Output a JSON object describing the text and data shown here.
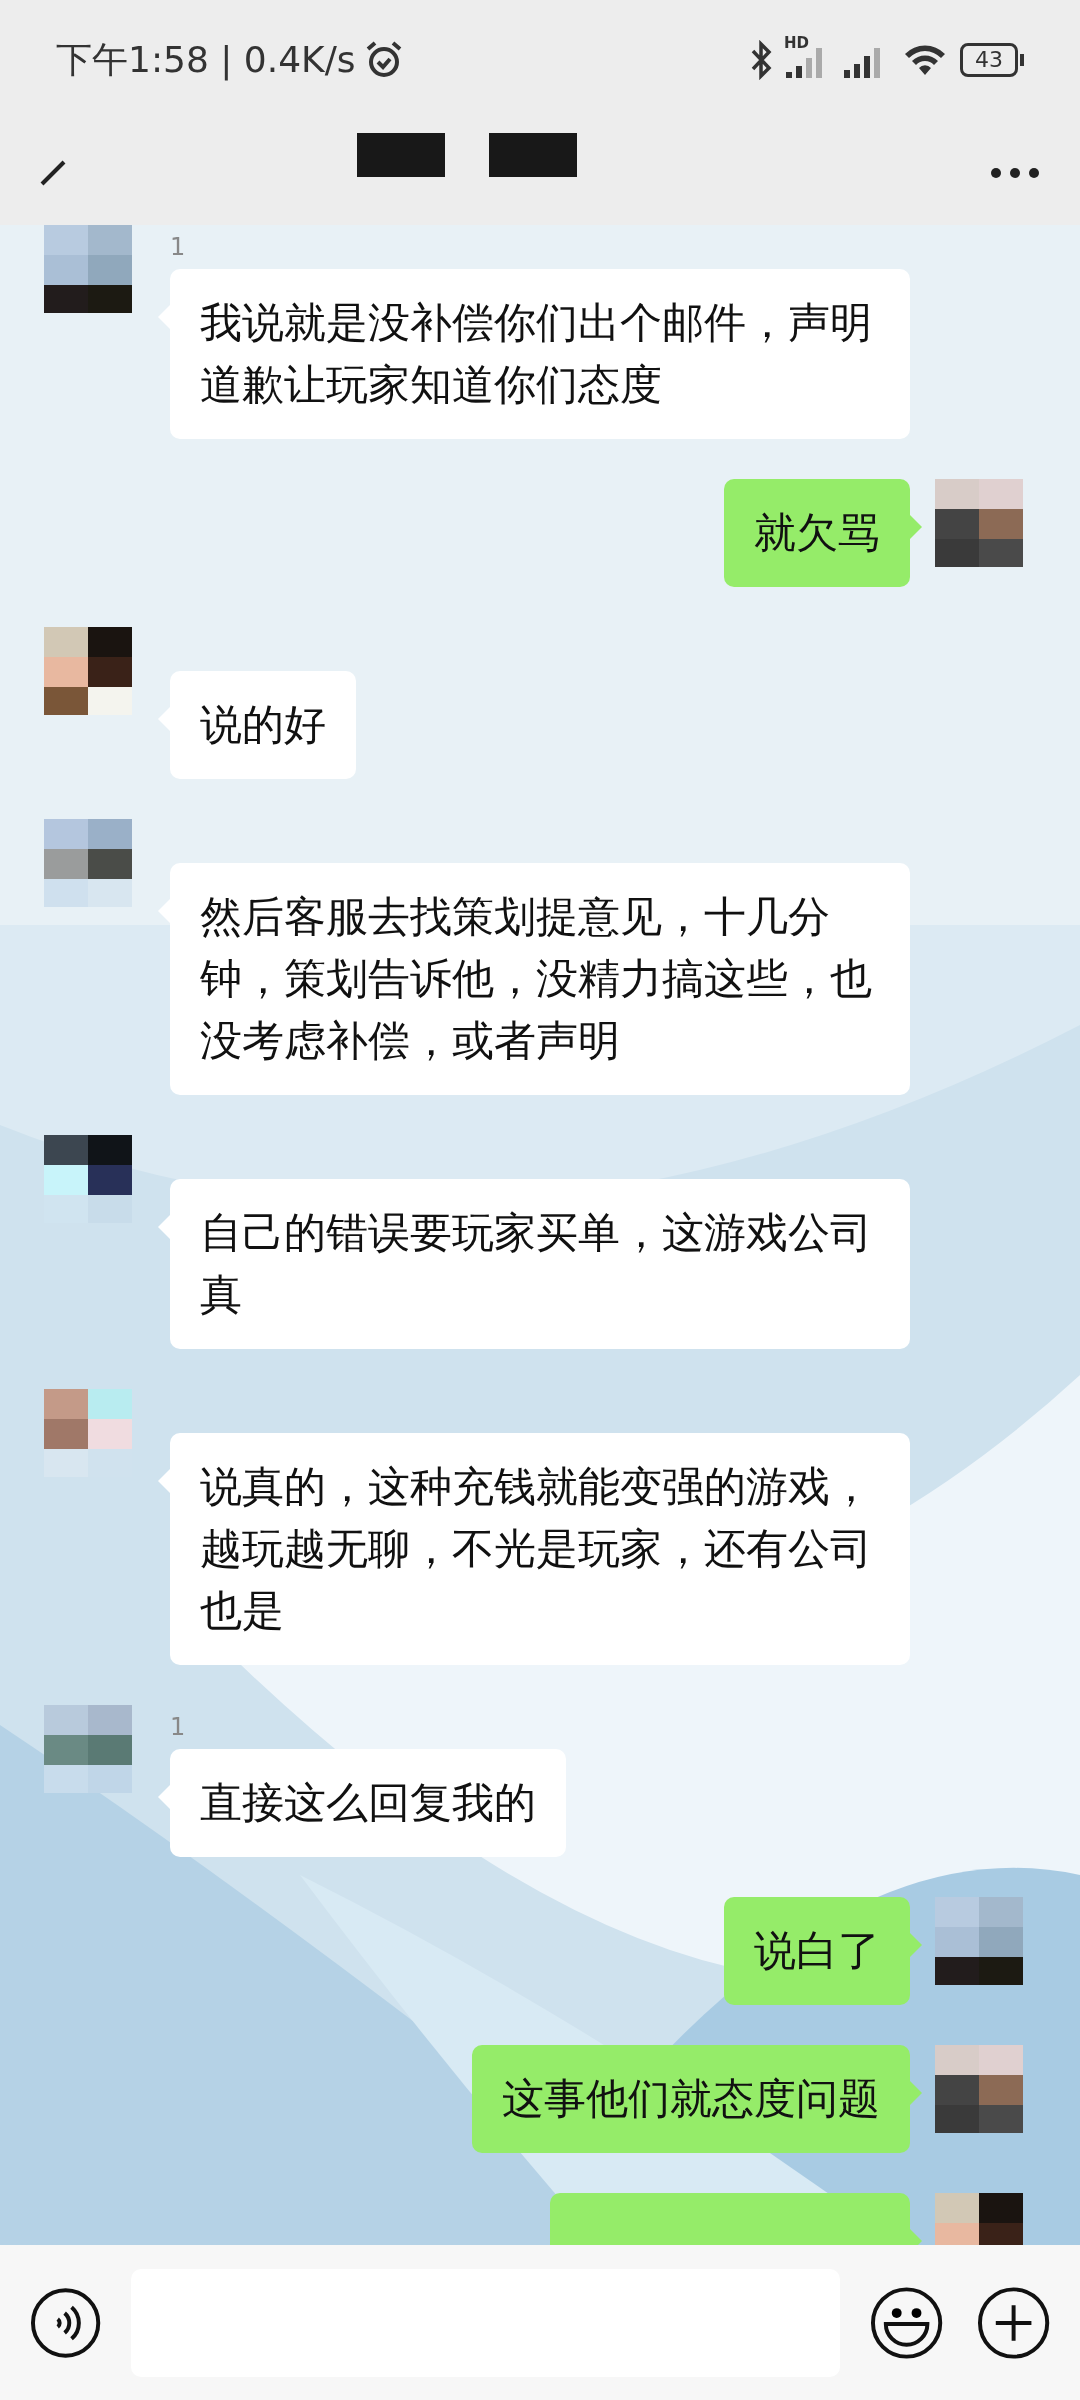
{
  "status_bar": {
    "time": "下午1:58 | 0.4K/s",
    "network_label": "HD",
    "battery": "43"
  },
  "messages": [
    {
      "kind": "received",
      "sender": "1",
      "text": "我说就是没补偿你们出个邮件，声明道歉让玩家知道你们态度"
    },
    {
      "kind": "sent",
      "text": "就欠骂"
    },
    {
      "kind": "received",
      "text": "说的好"
    },
    {
      "kind": "received",
      "text": "然后客服去找策划提意见，十几分钟，策划告诉他，没精力搞这些，也没考虑补偿，或者声明"
    },
    {
      "kind": "received",
      "text": "自己的错误要玩家买单，这游戏公司真"
    },
    {
      "kind": "received",
      "text": "说真的，这种充钱就能变强的游戏，越玩越无聊，不光是玩家，还有公司也是"
    },
    {
      "kind": "received",
      "sender": "1",
      "text": "直接这么回复我的"
    },
    {
      "kind": "sent",
      "text": "说白了"
    },
    {
      "kind": "sent",
      "text": "这事他们就态度问题"
    },
    {
      "kind": "sent"
    }
  ]
}
